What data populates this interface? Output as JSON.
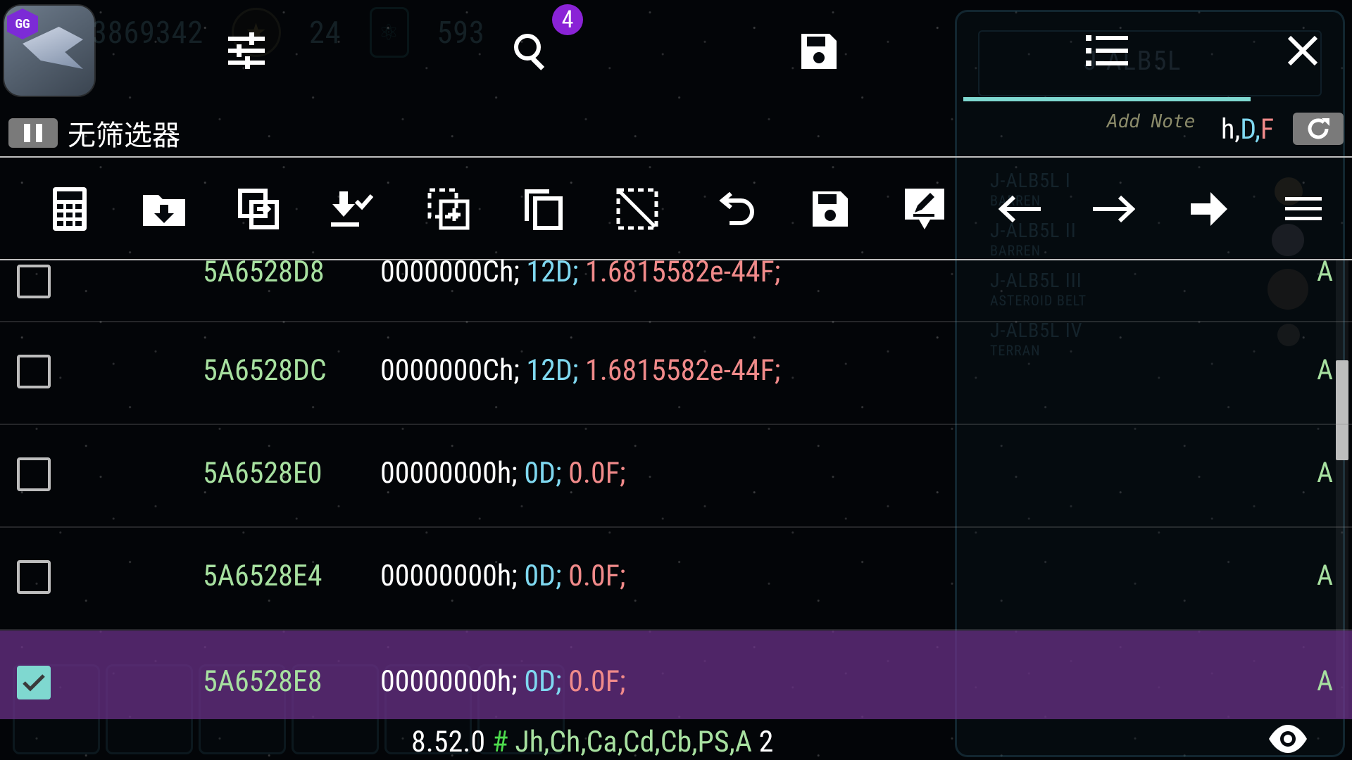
{
  "game": {
    "score": "3869342",
    "stars": "24",
    "resource": "593",
    "planet_panel_title": "J-ALB5L",
    "planets": [
      {
        "name": "J-ALB5L I",
        "type": "BARREN"
      },
      {
        "name": "J-ALB5L II",
        "type": "BARREN"
      },
      {
        "name": "J-ALB5L III",
        "type": "ASTEROID BELT"
      },
      {
        "name": "J-ALB5L IV",
        "type": "TERRAN"
      }
    ]
  },
  "app": {
    "icon_text": "GG",
    "search_badge": "4",
    "filter_label": "无筛选器",
    "add_note_placeholder": "Add Note",
    "types": {
      "h": "h,",
      "d": "D,",
      "f": "F"
    }
  },
  "results": [
    {
      "address": "5A6528D8",
      "hex": "0000000Ch;",
      "dec": "12D;",
      "float": "1.6815582e-44F;",
      "flag": "A",
      "checked": false
    },
    {
      "address": "5A6528DC",
      "hex": "0000000Ch;",
      "dec": "12D;",
      "float": "1.6815582e-44F;",
      "flag": "A",
      "checked": false
    },
    {
      "address": "5A6528E0",
      "hex": "00000000h;",
      "dec": "0D;",
      "float": "0.0F;",
      "flag": "A",
      "checked": false
    },
    {
      "address": "5A6528E4",
      "hex": "00000000h;",
      "dec": "0D;",
      "float": "0.0F;",
      "flag": "A",
      "checked": false
    },
    {
      "address": "5A6528E8",
      "hex": "00000000h;",
      "dec": "0D;",
      "float": "0.0F;",
      "flag": "A",
      "checked": true
    }
  ],
  "status": {
    "version": "8.52.0",
    "hash": "#",
    "types": "Jh,Ch,Ca,Cd,Cb,PS,A",
    "count": "2"
  },
  "colors": {
    "selection": "#6e328c",
    "address": "#a7e0a0",
    "decimal": "#7fd8f0",
    "float": "#f08a8a",
    "accent": "#7fd8d0",
    "badge": "#8a23d6"
  },
  "icons": [
    "settings-sliders-icon",
    "search-icon",
    "save-icon",
    "list-icon",
    "close-icon",
    "calculator-icon",
    "folder-download-icon",
    "copy-transfer-icon",
    "save-list-icon",
    "copy-selection-icon",
    "copy-icon",
    "deselect-icon",
    "undo-icon",
    "save-selected-icon",
    "edit-icon",
    "arrow-left-icon",
    "arrow-right-icon",
    "arrow-right-bold-icon",
    "menu-icon",
    "refresh-icon",
    "eye-icon"
  ]
}
